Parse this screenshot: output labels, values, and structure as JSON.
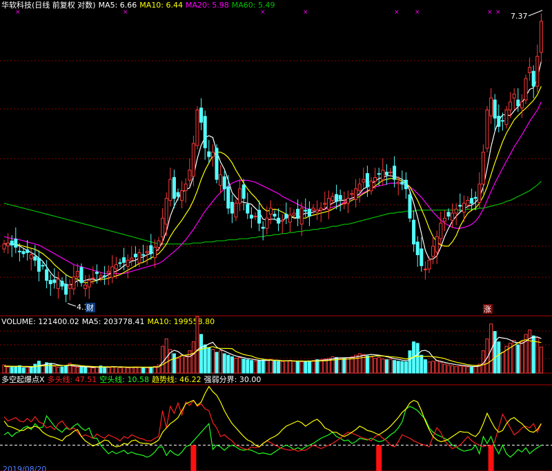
{
  "price_header": {
    "stock": "华软科技(日线 前复权 对数)",
    "ma5": "MA5: 6.66",
    "ma10": "MA10: 6.44",
    "ma20": "MA20: 5.98",
    "ma60": "MA60: 5.49"
  },
  "volume_header": {
    "volume": "VOLUME: 121400.02",
    "ma5": "MA5: 203778.41",
    "ma10": "MA10: 199558.80"
  },
  "osc_header": {
    "name": "多空起爆点X",
    "bull": "多头线: 47.51",
    "bear": "空头线: 10.58",
    "trend": "趋势线: 46.22",
    "divide": "强弱分界: 30.00"
  },
  "annotations": {
    "high": "7.37",
    "low": "4.1",
    "badge_finance": "财",
    "badge_limit_up": "涨",
    "date_label": "2019/08/20"
  },
  "colors": {
    "up": "#ff3a3a",
    "down": "#54ffff",
    "ma5": "#ffffff",
    "ma10": "#ffff00",
    "ma20": "#ff00ff",
    "ma60": "#00c000",
    "bull": "#ff2020",
    "bear": "#20ff20",
    "trend": "#ffff00",
    "grid": "#8b0000"
  },
  "chart_data": {
    "type": "candlestick",
    "price_range": [
      4.1,
      7.37
    ],
    "close": [
      4.65,
      4.66,
      4.64,
      4.62,
      4.58,
      4.56,
      4.57,
      4.55,
      4.5,
      4.4,
      4.45,
      4.32,
      4.29,
      4.3,
      4.33,
      4.27,
      4.2,
      4.28,
      4.35,
      4.4,
      4.3,
      4.28,
      4.32,
      4.34,
      4.38,
      4.36,
      4.35,
      4.4,
      4.44,
      4.46,
      4.47,
      4.48,
      4.5,
      4.52,
      4.53,
      4.57,
      4.55,
      4.58,
      4.56,
      4.62,
      4.68,
      4.9,
      5.1,
      5.3,
      5.1,
      5.12,
      5.18,
      5.25,
      5.4,
      5.7,
      6.1,
      5.95,
      5.65,
      5.55,
      5.6,
      5.3,
      5.35,
      5.2,
      5.0,
      4.95,
      5.05,
      5.2,
      5.1,
      4.95,
      4.9,
      4.92,
      4.85,
      4.8,
      4.9,
      5.0,
      4.92,
      4.85,
      4.88,
      4.9,
      4.93,
      4.95,
      4.9,
      5.0,
      4.97,
      4.92,
      5.0,
      4.98,
      5.0,
      5.05,
      5.1,
      5.12,
      5.07,
      5.09,
      5.05,
      5.1,
      5.15,
      5.2,
      5.25,
      5.3,
      5.22,
      5.28,
      5.32,
      5.36,
      5.4,
      5.35,
      5.38,
      5.3,
      5.27,
      5.25,
      5.2,
      4.9,
      4.65,
      4.55,
      4.45,
      4.42,
      4.5,
      4.63,
      4.72,
      4.85,
      4.9,
      4.92,
      4.95,
      4.99,
      5.02,
      5.05,
      5.08,
      5.05,
      5.1,
      5.25,
      5.6,
      6.1,
      6.25,
      6.0,
      5.9,
      5.97,
      6.1,
      6.2,
      6.3,
      6.15,
      6.2,
      6.5,
      6.65,
      6.4,
      6.8,
      7.3
    ],
    "ma5": [
      4.65,
      4.65,
      4.65,
      4.64,
      4.63,
      4.61,
      4.59,
      4.57,
      4.55,
      4.52,
      4.49,
      4.44,
      4.39,
      4.35,
      4.34,
      4.3,
      4.28,
      4.28,
      4.29,
      4.32,
      4.31,
      4.32,
      4.33,
      4.33,
      4.32,
      4.34,
      4.35,
      4.37,
      4.39,
      4.4,
      4.42,
      4.45,
      4.47,
      4.49,
      4.5,
      4.52,
      4.53,
      4.55,
      4.56,
      4.58,
      4.6,
      4.67,
      4.77,
      4.92,
      5.02,
      5.1,
      5.16,
      5.19,
      5.21,
      5.33,
      5.53,
      5.68,
      5.77,
      5.79,
      5.77,
      5.61,
      5.49,
      5.41,
      5.29,
      5.16,
      5.11,
      5.07,
      5.06,
      5.05,
      5.04,
      5.0,
      4.96,
      4.89,
      4.88,
      4.89,
      4.89,
      4.87,
      4.87,
      4.91,
      4.92,
      4.9,
      4.9,
      4.93,
      4.95,
      4.95,
      4.96,
      4.97,
      4.98,
      4.99,
      5.03,
      5.05,
      5.07,
      5.08,
      5.08,
      5.09,
      5.1,
      5.12,
      5.15,
      5.2,
      5.22,
      5.25,
      5.28,
      5.31,
      5.32,
      5.34,
      5.34,
      5.33,
      5.32,
      5.3,
      5.27,
      5.18,
      5.05,
      4.91,
      4.75,
      4.59,
      4.51,
      4.51,
      4.54,
      4.62,
      4.72,
      4.8,
      4.87,
      4.92,
      4.96,
      4.99,
      5.02,
      5.03,
      5.06,
      5.11,
      5.22,
      5.42,
      5.66,
      5.84,
      5.97,
      6.04,
      6.04,
      6.03,
      6.09,
      6.14,
      6.19,
      6.27,
      6.36,
      6.38,
      6.51,
      6.73
    ],
    "ma10": [
      4.65,
      4.65,
      4.65,
      4.65,
      4.64,
      4.63,
      4.62,
      4.61,
      4.6,
      4.58,
      4.56,
      4.53,
      4.5,
      4.46,
      4.43,
      4.4,
      4.37,
      4.35,
      4.34,
      4.33,
      4.31,
      4.3,
      4.3,
      4.31,
      4.32,
      4.33,
      4.33,
      4.34,
      4.35,
      4.36,
      4.37,
      4.39,
      4.41,
      4.43,
      4.45,
      4.47,
      4.48,
      4.5,
      4.52,
      4.54,
      4.56,
      4.6,
      4.65,
      4.72,
      4.78,
      4.83,
      4.88,
      4.94,
      5.0,
      5.08,
      5.18,
      5.3,
      5.4,
      5.48,
      5.56,
      5.6,
      5.6,
      5.58,
      5.54,
      5.48,
      5.4,
      5.33,
      5.26,
      5.2,
      5.15,
      5.11,
      5.06,
      5.0,
      4.97,
      4.98,
      4.99,
      4.98,
      4.96,
      4.94,
      4.92,
      4.91,
      4.9,
      4.9,
      4.9,
      4.92,
      4.93,
      4.94,
      4.95,
      4.96,
      4.97,
      4.99,
      5.01,
      5.03,
      5.05,
      5.06,
      5.08,
      5.1,
      5.12,
      5.15,
      5.17,
      5.2,
      5.23,
      5.26,
      5.29,
      5.3,
      5.31,
      5.31,
      5.3,
      5.28,
      5.26,
      5.22,
      5.15,
      5.08,
      4.99,
      4.9,
      4.8,
      4.72,
      4.67,
      4.64,
      4.63,
      4.63,
      4.67,
      4.73,
      4.82,
      4.89,
      4.95,
      4.98,
      5.0,
      5.05,
      5.12,
      5.22,
      5.35,
      5.48,
      5.6,
      5.72,
      5.82,
      5.9,
      5.98,
      6.03,
      6.08,
      6.12,
      6.17,
      6.22,
      6.29,
      6.4
    ],
    "ma20": [
      4.72,
      4.71,
      4.7,
      4.7,
      4.69,
      4.68,
      4.67,
      4.66,
      4.65,
      4.64,
      4.62,
      4.6,
      4.58,
      4.56,
      4.54,
      4.52,
      4.5,
      4.48,
      4.46,
      4.45,
      4.44,
      4.43,
      4.42,
      4.41,
      4.4,
      4.39,
      4.38,
      4.38,
      4.38,
      4.38,
      4.38,
      4.38,
      4.39,
      4.4,
      4.41,
      4.42,
      4.43,
      4.44,
      4.45,
      4.46,
      4.47,
      4.49,
      4.52,
      4.55,
      4.58,
      4.61,
      4.65,
      4.69,
      4.74,
      4.79,
      4.85,
      4.91,
      4.97,
      5.02,
      5.07,
      5.12,
      5.16,
      5.2,
      5.23,
      5.26,
      5.28,
      5.29,
      5.29,
      5.29,
      5.28,
      5.27,
      5.25,
      5.23,
      5.21,
      5.19,
      5.17,
      5.15,
      5.12,
      5.1,
      5.08,
      5.06,
      5.04,
      5.02,
      5.0,
      4.99,
      4.98,
      4.98,
      4.98,
      4.99,
      5.0,
      5.01,
      5.02,
      5.04,
      5.06,
      5.08,
      5.1,
      5.12,
      5.14,
      5.16,
      5.18,
      5.2,
      5.22,
      5.23,
      5.24,
      5.25,
      5.26,
      5.26,
      5.26,
      5.25,
      5.24,
      5.22,
      5.19,
      5.15,
      5.11,
      5.06,
      5.01,
      4.96,
      4.92,
      4.88,
      4.85,
      4.83,
      4.81,
      4.8,
      4.8,
      4.81,
      4.82,
      4.84,
      4.87,
      4.92,
      4.99,
      5.08,
      5.17,
      5.26,
      5.34,
      5.42,
      5.5,
      5.58,
      5.66,
      5.73,
      5.8,
      5.88,
      5.96,
      6.03,
      6.1,
      6.2
    ],
    "ma60": [
      5.05,
      5.04,
      5.03,
      5.02,
      5.01,
      5.0,
      4.99,
      4.98,
      4.97,
      4.96,
      4.95,
      4.94,
      4.93,
      4.92,
      4.91,
      4.9,
      4.89,
      4.88,
      4.87,
      4.86,
      4.85,
      4.84,
      4.83,
      4.82,
      4.81,
      4.8,
      4.79,
      4.78,
      4.77,
      4.76,
      4.75,
      4.74,
      4.73,
      4.72,
      4.71,
      4.7,
      4.69,
      4.68,
      4.67,
      4.66,
      4.65,
      4.65,
      4.65,
      4.65,
      4.65,
      4.65,
      4.65,
      4.65,
      4.65,
      4.66,
      4.66,
      4.66,
      4.67,
      4.67,
      4.67,
      4.68,
      4.68,
      4.68,
      4.69,
      4.69,
      4.69,
      4.7,
      4.7,
      4.7,
      4.71,
      4.71,
      4.72,
      4.72,
      4.73,
      4.73,
      4.74,
      4.74,
      4.75,
      4.75,
      4.76,
      4.76,
      4.77,
      4.77,
      4.78,
      4.78,
      4.79,
      4.79,
      4.8,
      4.8,
      4.81,
      4.82,
      4.82,
      4.83,
      4.84,
      4.84,
      4.85,
      4.86,
      4.87,
      4.88,
      4.89,
      4.9,
      4.91,
      4.92,
      4.93,
      4.94,
      4.95,
      4.95,
      4.96,
      4.96,
      4.97,
      4.97,
      4.97,
      4.98,
      4.98,
      4.98,
      4.98,
      4.98,
      4.98,
      4.98,
      4.98,
      4.98,
      4.98,
      4.98,
      4.98,
      4.98,
      4.99,
      4.99,
      4.99,
      5.0,
      5.0,
      5.01,
      5.02,
      5.03,
      5.04,
      5.05,
      5.07,
      5.08,
      5.1,
      5.12,
      5.14,
      5.16,
      5.18,
      5.21,
      5.24,
      5.28
    ],
    "volume": [
      55,
      40,
      45,
      42,
      50,
      35,
      40,
      38,
      60,
      80,
      55,
      70,
      65,
      45,
      40,
      42,
      50,
      65,
      45,
      40,
      42,
      38,
      40,
      35,
      42,
      48,
      40,
      38,
      45,
      42,
      36,
      40,
      35,
      38,
      42,
      40,
      38,
      36,
      40,
      45,
      55,
      180,
      230,
      160,
      130,
      100,
      120,
      110,
      150,
      210,
      380,
      260,
      190,
      170,
      160,
      140,
      150,
      130,
      120,
      110,
      100,
      105,
      95,
      90,
      85,
      80,
      85,
      88,
      90,
      92,
      85,
      80,
      78,
      82,
      85,
      80,
      78,
      76,
      80,
      82,
      85,
      90,
      92,
      95,
      100,
      110,
      105,
      98,
      100,
      105,
      110,
      120,
      130,
      125,
      115,
      110,
      100,
      105,
      95,
      90,
      95,
      85,
      80,
      78,
      76,
      150,
      210,
      200,
      120,
      90,
      75,
      80,
      85,
      70,
      60,
      55,
      50,
      45,
      48,
      45,
      42,
      40,
      45,
      60,
      150,
      230,
      330,
      280,
      210,
      140,
      180,
      200,
      220,
      190,
      210,
      260,
      290,
      250,
      240,
      175
    ],
    "volume_ma5": [
      45,
      45,
      45,
      44,
      46,
      42,
      42,
      41,
      44,
      50,
      54,
      60,
      66,
      62,
      55,
      52,
      50,
      52,
      49,
      46,
      44,
      42,
      41,
      39,
      40,
      41,
      41,
      40,
      42,
      43,
      40,
      40,
      39,
      38,
      38,
      39,
      39,
      38,
      39,
      40,
      41,
      71,
      104,
      137,
      153,
      145,
      125,
      114,
      110,
      126,
      156,
      174,
      182,
      196,
      207,
      175,
      159,
      148,
      136,
      124,
      115,
      109,
      104,
      98,
      94,
      90,
      86,
      85,
      85,
      86,
      86,
      86,
      83,
      83,
      83,
      81,
      80,
      80,
      80,
      80,
      81,
      83,
      85,
      88,
      90,
      96,
      100,
      102,
      103,
      104,
      104,
      108,
      113,
      118,
      122,
      125,
      123,
      120,
      116,
      110,
      104,
      97,
      93,
      87,
      84,
      91,
      108,
      126,
      149,
      153,
      141,
      107,
      83,
      79,
      72,
      66,
      61,
      57,
      54,
      51,
      47,
      45,
      44,
      47,
      66,
      102,
      154,
      209,
      240,
      236,
      232,
      222,
      208,
      204,
      199,
      213,
      234,
      241,
      243,
      232
    ],
    "volume_ma10": [
      47,
      47,
      46,
      46,
      46,
      45,
      45,
      44,
      45,
      47,
      49,
      50,
      51,
      51,
      50,
      51,
      52,
      55,
      57,
      54,
      50,
      47,
      46,
      44,
      42,
      42,
      42,
      42,
      41,
      41,
      42,
      41,
      40,
      40,
      40,
      40,
      40,
      40,
      40,
      41,
      43,
      56,
      72,
      88,
      97,
      105,
      117,
      121,
      124,
      133,
      150,
      160,
      167,
      172,
      178,
      168,
      166,
      165,
      165,
      164,
      145,
      135,
      125,
      119,
      115,
      104,
      98,
      94,
      90,
      88,
      86,
      85,
      83,
      82,
      82,
      82,
      81,
      81,
      80,
      80,
      81,
      81,
      82,
      83,
      85,
      88,
      90,
      92,
      93,
      94,
      96,
      98,
      101,
      105,
      107,
      111,
      115,
      116,
      115,
      113,
      110,
      108,
      105,
      100,
      95,
      100,
      108,
      113,
      112,
      112,
      112,
      110,
      107,
      103,
      98,
      88,
      80,
      73,
      68,
      62,
      56,
      53,
      51,
      51,
      55,
      64,
      82,
      103,
      124,
      138,
      155,
      171,
      187,
      203,
      218,
      224,
      217,
      213,
      210,
      205
    ],
    "bull": [
      63,
      58,
      60,
      62,
      58,
      57,
      61,
      57,
      63,
      57,
      55,
      50,
      52,
      48,
      55,
      58,
      52,
      48,
      50,
      45,
      40,
      42,
      40,
      38,
      43,
      40,
      38,
      42,
      40,
      38,
      35,
      40,
      38,
      42,
      40,
      38,
      37,
      35,
      35,
      38,
      40,
      70,
      50,
      75,
      67,
      79,
      65,
      80,
      76,
      82,
      75,
      78,
      72,
      70,
      56,
      50,
      40,
      42,
      38,
      35,
      30,
      28,
      26,
      25,
      28,
      27,
      28,
      32,
      35,
      33,
      30,
      28,
      26,
      25,
      24,
      25,
      23,
      24,
      24,
      27,
      30,
      28,
      26,
      28,
      30,
      32,
      35,
      38,
      42,
      45,
      44,
      42,
      40,
      38,
      37,
      35,
      40,
      42,
      38,
      35,
      30,
      28,
      34,
      42,
      40,
      38,
      35,
      33,
      31,
      30,
      28,
      40,
      50,
      45,
      35,
      30,
      26,
      28,
      30,
      35,
      40,
      35,
      32,
      30,
      28,
      30,
      26,
      35,
      50,
      66,
      58,
      50,
      42,
      45,
      50,
      52,
      50,
      55,
      45,
      55
    ],
    "bear": [
      42,
      45,
      40,
      44,
      46,
      50,
      52,
      48,
      55,
      50,
      51,
      64,
      58,
      52,
      48,
      45,
      50,
      48,
      52,
      55,
      50,
      47,
      50,
      38,
      38,
      30,
      25,
      20,
      23,
      20,
      22,
      24,
      20,
      22,
      20,
      19,
      18,
      16,
      18,
      22,
      28,
      28,
      18,
      24,
      20,
      18,
      22,
      28,
      30,
      35,
      40,
      45,
      50,
      55,
      25,
      30,
      28,
      24,
      28,
      30,
      28,
      25,
      24,
      25,
      24,
      22,
      20,
      21,
      20,
      19,
      22,
      25,
      28,
      30,
      28,
      25,
      27,
      25,
      28,
      30,
      32,
      35,
      38,
      40,
      42,
      45,
      40,
      38,
      35,
      36,
      32,
      34,
      38,
      37,
      36,
      38,
      36,
      34,
      35,
      38,
      42,
      45,
      50,
      57,
      72,
      75,
      73,
      70,
      65,
      60,
      50,
      45,
      42,
      40,
      38,
      35,
      30,
      28,
      25,
      23,
      24,
      25,
      30,
      20,
      40,
      32,
      40,
      28,
      20,
      30,
      20,
      16,
      20,
      25,
      22,
      27,
      20,
      24,
      27,
      30
    ],
    "trend": [
      58,
      52,
      51,
      49,
      47,
      47,
      50,
      50,
      52,
      50,
      45,
      42,
      40,
      39,
      37,
      35,
      40,
      42,
      46,
      48,
      40,
      35,
      32,
      29,
      31,
      33,
      36,
      35,
      30,
      28,
      29,
      32,
      31,
      35,
      36,
      33,
      32,
      32,
      31,
      33,
      36,
      45,
      50,
      55,
      58,
      62,
      70,
      78,
      80,
      82,
      76,
      80,
      90,
      98,
      92,
      88,
      80,
      70,
      62,
      55,
      50,
      45,
      40,
      36,
      34,
      30,
      28,
      32,
      35,
      38,
      40,
      43,
      48,
      52,
      54,
      56,
      58,
      56,
      52,
      55,
      58,
      60,
      56,
      50,
      48,
      45,
      45,
      42,
      40,
      42,
      45,
      48,
      52,
      50,
      47,
      46,
      44,
      42,
      45,
      48,
      52,
      57,
      62,
      68,
      72,
      79,
      82,
      80,
      70,
      58,
      48,
      40,
      36,
      34,
      35,
      37,
      40,
      43,
      46,
      45,
      45,
      42,
      40,
      45,
      55,
      67,
      58,
      50,
      45,
      47,
      55,
      60,
      62,
      58,
      55,
      50,
      46,
      45,
      48,
      55
    ],
    "trigger_days": [
      49,
      97,
      126
    ],
    "threshold": 30
  }
}
